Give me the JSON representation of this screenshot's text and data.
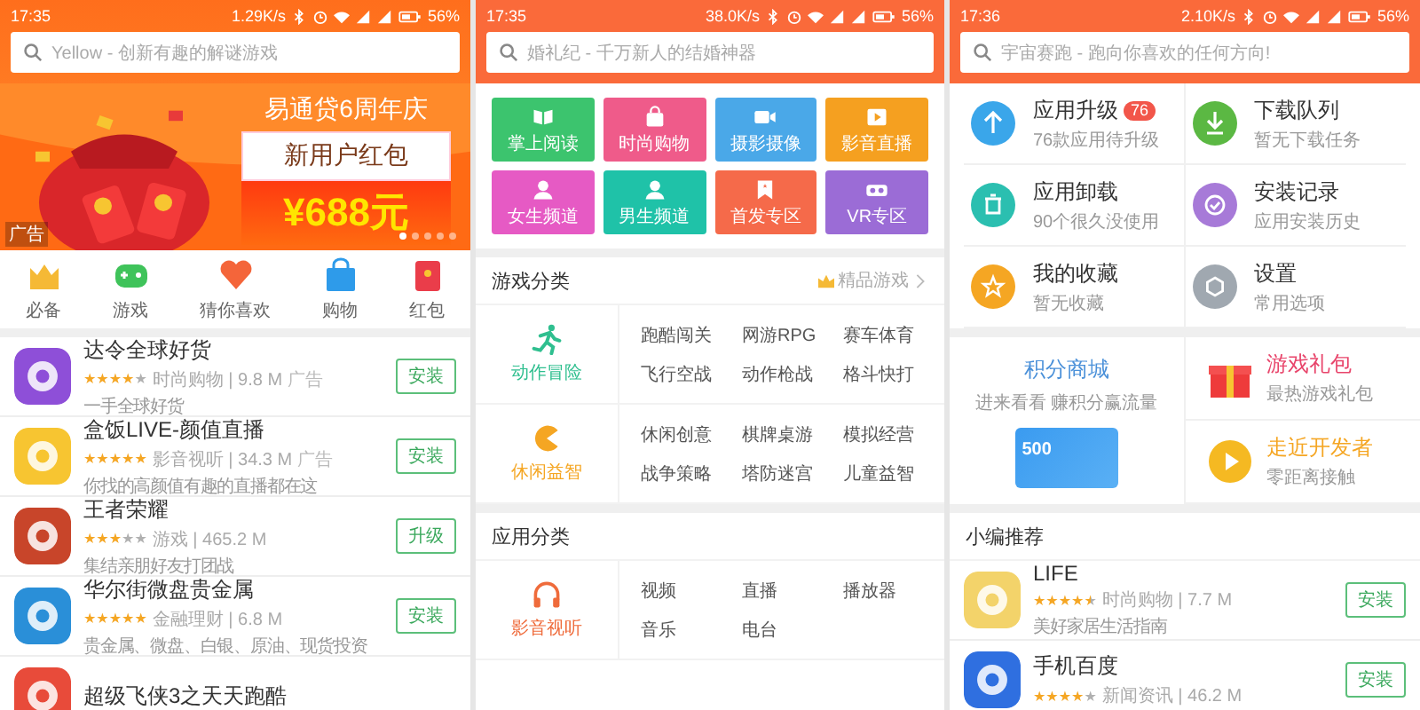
{
  "featured_screen": {
    "status_bar": {
      "time": "17:35",
      "speed": "1.29K/s",
      "battery": "56%"
    },
    "search": {
      "placeholder": "Yellow - 创新有趣的解谜游戏"
    },
    "banner": {
      "headline": "易通贷6周年庆",
      "offer": "新用户红包",
      "amount": "¥688元",
      "ad_tag": "广告",
      "pages": [
        {
          "selected": true
        },
        {
          "selected": false
        },
        {
          "selected": false
        },
        {
          "selected": false
        },
        {
          "selected": false
        }
      ]
    },
    "shortcuts": [
      "必备",
      "游戏",
      "猜你喜欢",
      "购物",
      "红包"
    ],
    "apps": [
      {
        "name": "达令全球好货",
        "stars": 4,
        "meta": "时尚购物 | 9.8 M",
        "ad": "广告",
        "description": "一手全球好货",
        "button": "安装"
      },
      {
        "name": "盒饭LIVE-颜值直播",
        "stars": 5,
        "meta": "影音视听 | 34.3 M",
        "ad": "广告",
        "description": "你找的高颜值有趣的直播都在这",
        "button": "安装"
      },
      {
        "name": "王者荣耀",
        "stars": 3,
        "meta": "游戏 | 465.2 M",
        "description": "集结亲朋好友打团战",
        "button": "升级"
      },
      {
        "name": "华尔街微盘贵金属",
        "stars": 5,
        "meta": "金融理财 | 6.8 M",
        "description": "贵金属、微盘、白银、原油、现货投资",
        "button": "安装"
      },
      {
        "name": "超级飞侠3之天天跑酷"
      }
    ]
  },
  "category_screen": {
    "status_bar": {
      "time": "17:35",
      "speed": "38.0K/s",
      "battery": "56%"
    },
    "search": {
      "placeholder": "婚礼纪 - 千万新人的结婚神器"
    },
    "tiles": [
      {
        "label": "掌上阅读",
        "color": "#3cc46e"
      },
      {
        "label": "时尚购物",
        "color": "#ef5b8a"
      },
      {
        "label": "摄影摄像",
        "color": "#4aa8e8"
      },
      {
        "label": "影音直播",
        "color": "#f5a020"
      },
      {
        "label": "女生频道",
        "color": "#e65ac4"
      },
      {
        "label": "男生频道",
        "color": "#1fc2a8"
      },
      {
        "label": "首发专区",
        "color": "#f56a4a"
      },
      {
        "label": "VR专区",
        "color": "#9b6cd6"
      }
    ],
    "sections": [
      {
        "title": "游戏分类",
        "link": "精品游戏",
        "groups": [
          {
            "name": "动作冒险",
            "color": "#2fbf8f",
            "items": [
              "跑酷闯关",
              "网游RPG",
              "赛车体育",
              "飞行空战",
              "动作枪战",
              "格斗快打"
            ]
          },
          {
            "name": "休闲益智",
            "color": "#f5a623",
            "items": [
              "休闲创意",
              "棋牌桌游",
              "模拟经营",
              "战争策略",
              "塔防迷宫",
              "儿童益智"
            ]
          }
        ]
      },
      {
        "title": "应用分类",
        "groups": [
          {
            "name": "影音视听",
            "color": "#ef6b3b",
            "items": [
              "视频",
              "直播",
              "播放器",
              "音乐",
              "电台"
            ]
          }
        ]
      }
    ]
  },
  "manage_screen": {
    "status_bar": {
      "time": "17:36",
      "speed": "2.10K/s",
      "battery": "56%"
    },
    "search": {
      "placeholder": "宇宙赛跑 - 跑向你喜欢的任何方向!"
    },
    "tools": [
      {
        "title": "应用升级",
        "badge": "76",
        "subtitle": "76款应用待升级",
        "color": "#3aa6ea"
      },
      {
        "title": "下载队列",
        "subtitle": "暂无下载任务",
        "color": "#5bb843"
      },
      {
        "title": "应用卸载",
        "subtitle": "90个很久没使用",
        "color": "#2bbfb0"
      },
      {
        "title": "安装记录",
        "subtitle": "应用安装历史",
        "color": "#a77ad8"
      },
      {
        "title": "我的收藏",
        "subtitle": "暂无收藏",
        "color": "#f5a623"
      },
      {
        "title": "设置",
        "subtitle": "常用选项",
        "color": "#a0a8b0"
      }
    ],
    "points_store": {
      "title": "积分商城",
      "subtitle": "进来看看 赚积分赢流量",
      "card_value": "500",
      "color": "#4a90d9"
    },
    "promos": [
      {
        "title": "游戏礼包",
        "subtitle": "最热游戏礼包",
        "color": "#e8456b"
      },
      {
        "title": "走近开发者",
        "subtitle": "零距离接触",
        "color": "#f5a623"
      }
    ],
    "recommend": {
      "title": "小编推荐",
      "apps": [
        {
          "name": "LIFE",
          "stars": 4.5,
          "meta": "时尚购物 | 7.7 M",
          "description": "美好家居生活指南",
          "button": "安装"
        },
        {
          "name": "手机百度",
          "stars": 4,
          "meta": "新闻资讯 | 46.2 M",
          "button": "安装"
        }
      ]
    }
  }
}
